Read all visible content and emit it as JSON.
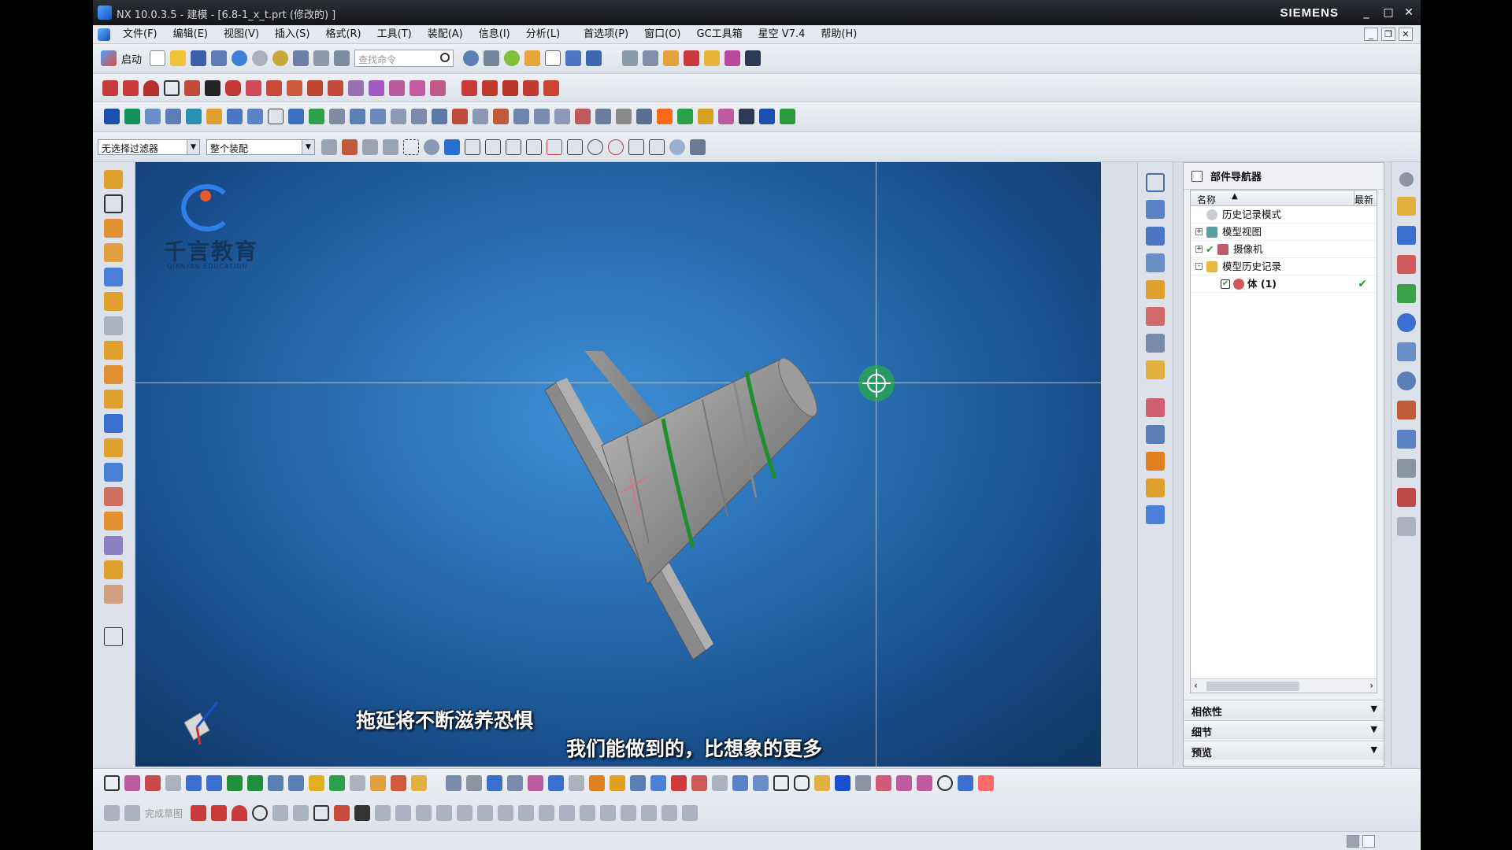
{
  "window": {
    "title": "NX 10.0.3.5 - 建模 - [6.8-1_x_t.prt  (修改的) ]",
    "brand": "SIEMENS",
    "controls": [
      "_",
      "□",
      "✕"
    ]
  },
  "menu": {
    "items": [
      "文件(F)",
      "编辑(E)",
      "视图(V)",
      "插入(S)",
      "格式(R)",
      "工具(T)",
      "装配(A)",
      "信息(I)",
      "分析(L)",
      "首选项(P)",
      "窗口(O)",
      "GC工具箱",
      "星空 V7.4",
      "帮助(H)"
    ],
    "mdi_controls": [
      "_",
      "❐",
      "✕"
    ]
  },
  "toolbar": {
    "start_label": "启动",
    "search_placeholder": "查找命令",
    "selection_filter": "无选择过滤器",
    "assembly_scope": "整个装配",
    "finish_sketch_label": "完成草图"
  },
  "viewport": {
    "watermark_title": "千言教育",
    "watermark_sub": "QIANYAN EDUCATION",
    "subtitle_line1": "拖延将不断滋养恐惧",
    "subtitle_line2": "我们能做到的，比想象的更多",
    "background_color": "#2a6fb4"
  },
  "navigator": {
    "title": "部件导航器",
    "columns": [
      "名称",
      "最新"
    ],
    "tree": [
      {
        "label": "历史记录模式",
        "level": 0,
        "expander": "",
        "checked": false,
        "latest": false
      },
      {
        "label": "模型视图",
        "level": 0,
        "expander": "+",
        "checked": false,
        "latest": false
      },
      {
        "label": "摄像机",
        "level": 0,
        "expander": "+",
        "checked": true,
        "latest": false
      },
      {
        "label": "模型历史记录",
        "level": 0,
        "expander": "-",
        "checked": false,
        "latest": false
      },
      {
        "label": "体 (1)",
        "level": 1,
        "expander": "",
        "checked": true,
        "latest": true
      }
    ],
    "sections": [
      "相依性",
      "细节",
      "预览"
    ]
  },
  "colors": {
    "accent_green": "#22a12b",
    "viewport_blue": "#2a6fb4",
    "model_grey": "#9a9a9a",
    "groove_green": "#1f8f2c"
  }
}
